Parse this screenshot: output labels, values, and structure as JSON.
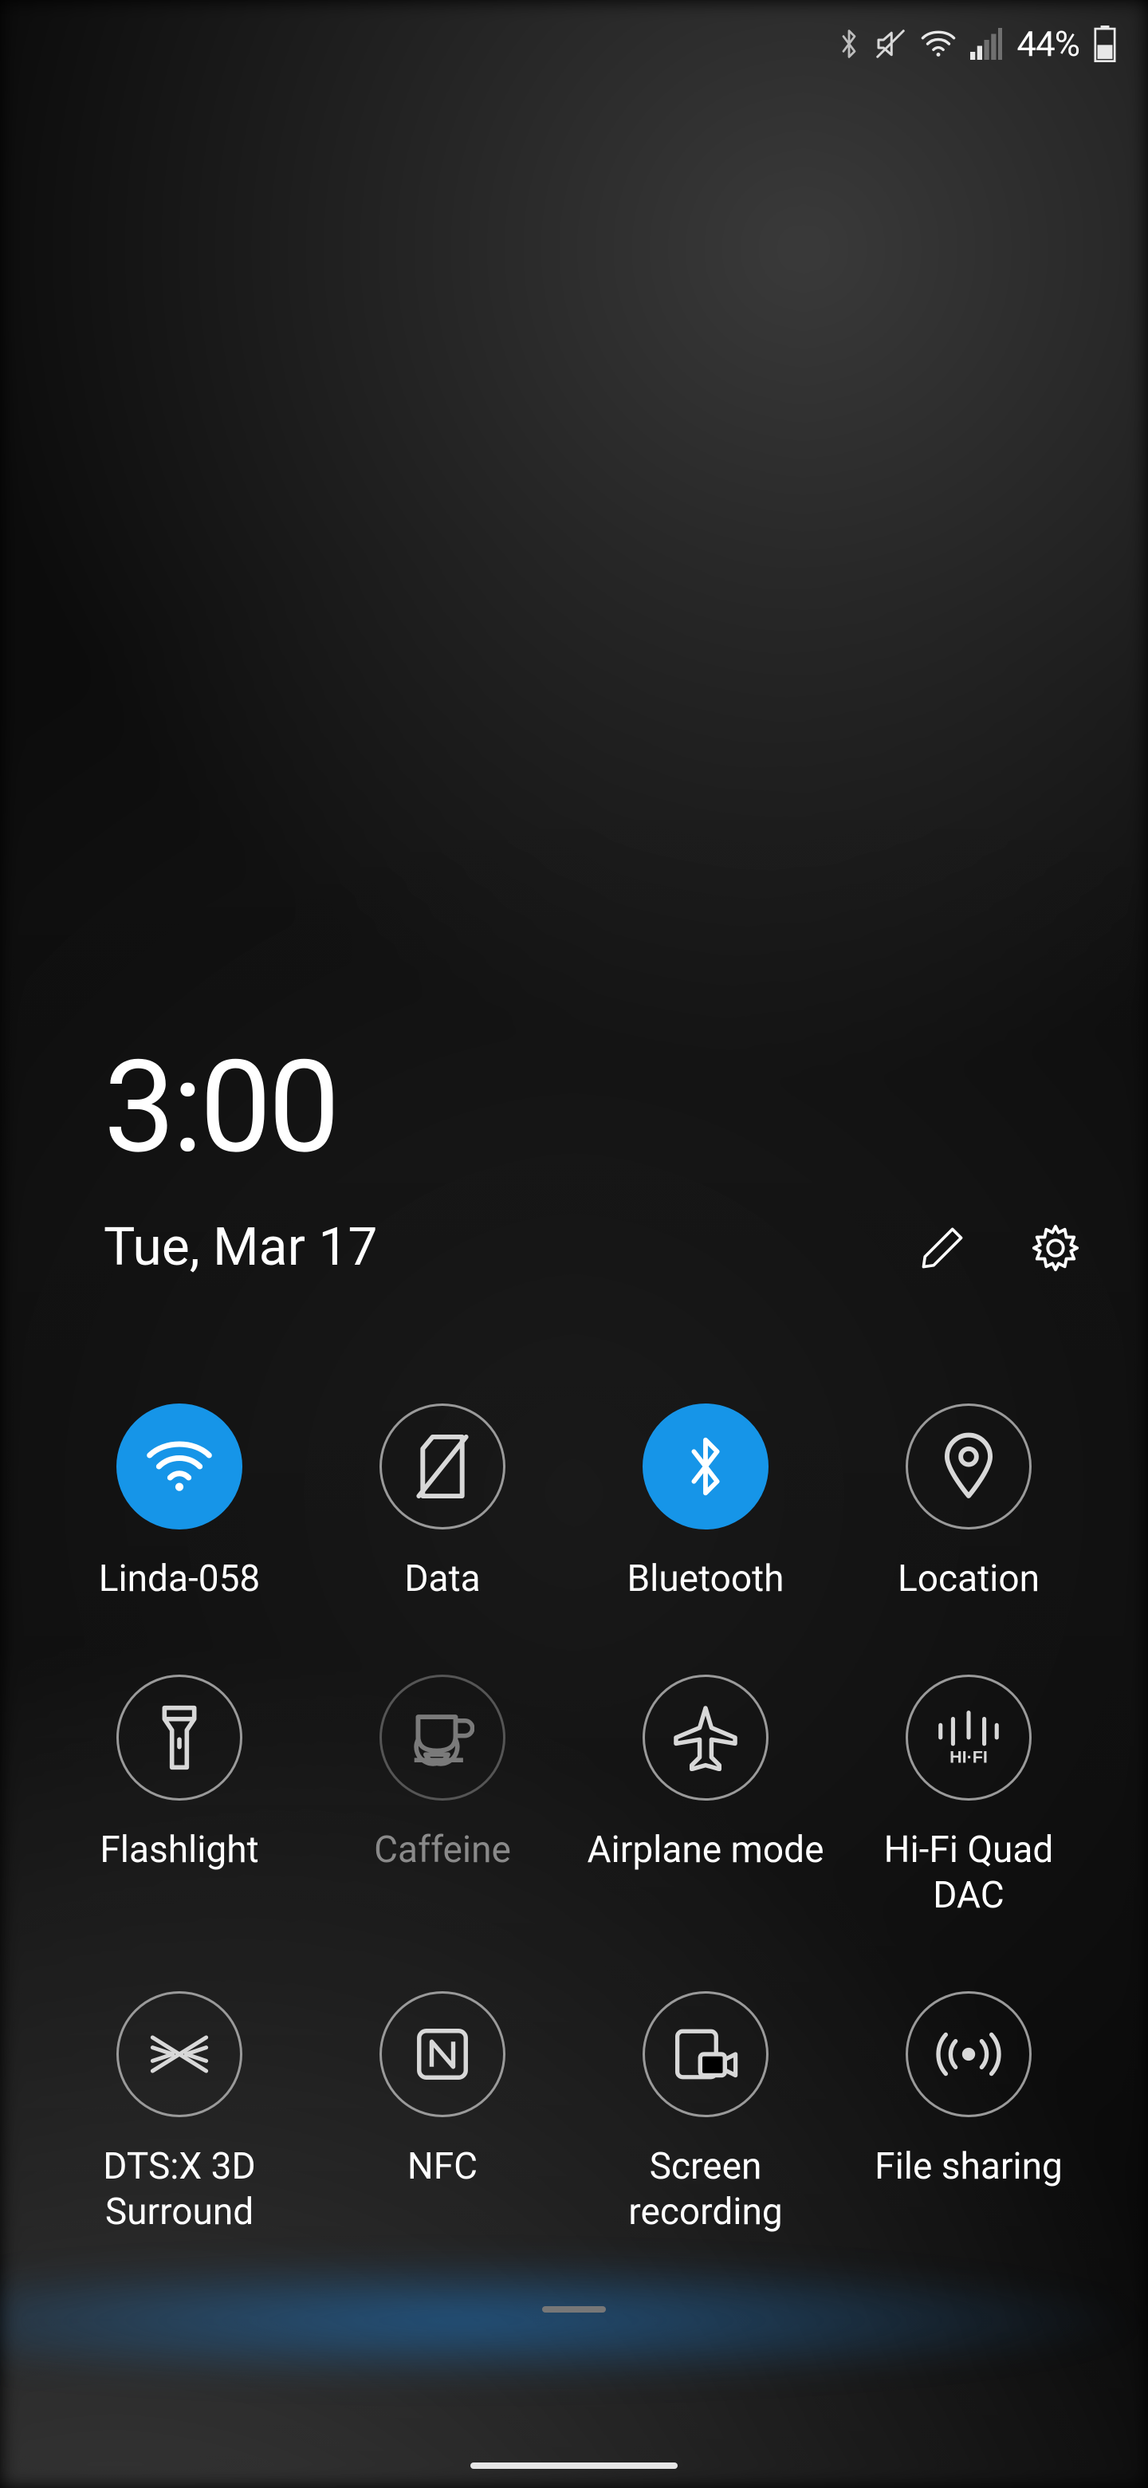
{
  "status_bar": {
    "battery_percent": "44%",
    "icons": {
      "bluetooth": "bluetooth-icon",
      "mute": "mute-icon",
      "wifi": "wifi-icon",
      "signal": "signal-icon",
      "battery": "battery-icon"
    }
  },
  "accent_color": "#1695e8",
  "header": {
    "time": "3:00",
    "date": "Tue, Mar 17",
    "edit_icon": "pencil-icon",
    "settings_icon": "gear-icon"
  },
  "quick_settings": [
    {
      "id": "wifi",
      "label": "Linda-058",
      "active": true,
      "dim": false,
      "icon": "wifi-icon"
    },
    {
      "id": "data",
      "label": "Data",
      "active": false,
      "dim": false,
      "icon": "sim-off-icon"
    },
    {
      "id": "bluetooth",
      "label": "Bluetooth",
      "active": true,
      "dim": false,
      "icon": "bluetooth-icon"
    },
    {
      "id": "location",
      "label": "Location",
      "active": false,
      "dim": false,
      "icon": "location-pin-icon"
    },
    {
      "id": "flashlight",
      "label": "Flashlight",
      "active": false,
      "dim": false,
      "icon": "flashlight-icon"
    },
    {
      "id": "caffeine",
      "label": "Caffeine",
      "active": false,
      "dim": true,
      "icon": "coffee-icon"
    },
    {
      "id": "airplane",
      "label": "Airplane mode",
      "active": false,
      "dim": false,
      "icon": "airplane-icon"
    },
    {
      "id": "hifi",
      "label": "Hi-Fi Quad DAC",
      "active": false,
      "dim": false,
      "icon": "hifi-icon"
    },
    {
      "id": "dtsx",
      "label": "DTS:X 3D Surround",
      "active": false,
      "dim": false,
      "icon": "dtsx-icon"
    },
    {
      "id": "nfc",
      "label": "NFC",
      "active": false,
      "dim": false,
      "icon": "nfc-icon"
    },
    {
      "id": "screenrec",
      "label": "Screen recording",
      "active": false,
      "dim": false,
      "icon": "screen-record-icon"
    },
    {
      "id": "fileshare",
      "label": "File sharing",
      "active": false,
      "dim": false,
      "icon": "file-sharing-icon"
    }
  ]
}
